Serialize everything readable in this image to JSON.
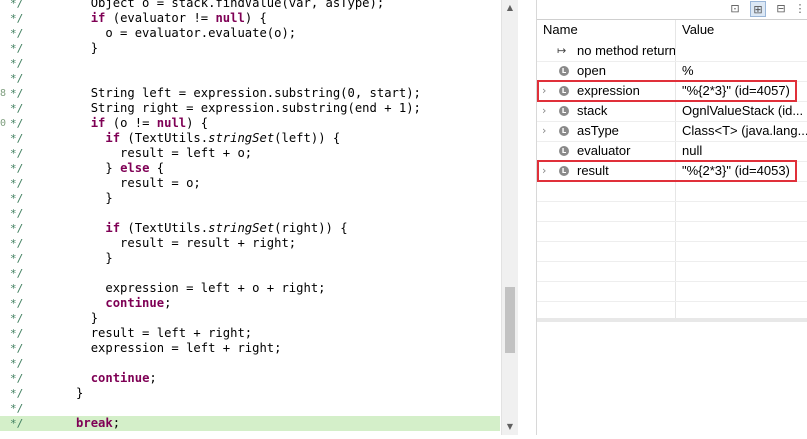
{
  "editor": {
    "lines": [
      {
        "g": "*/",
        "mark": "",
        "code": [
          {
            "t": "        Object o = stack.findValue(var, asType);"
          }
        ]
      },
      {
        "g": "*/",
        "mark": "",
        "code": [
          {
            "t": "        "
          },
          {
            "t": "if",
            "c": "kw"
          },
          {
            "t": " (evaluator != "
          },
          {
            "t": "null",
            "c": "kw"
          },
          {
            "t": ") {"
          }
        ]
      },
      {
        "g": "*/",
        "mark": "",
        "code": [
          {
            "t": "          o = evaluator.evaluate(o);"
          }
        ]
      },
      {
        "g": "*/",
        "mark": "",
        "code": [
          {
            "t": "        }"
          }
        ]
      },
      {
        "g": "*/",
        "mark": "",
        "code": []
      },
      {
        "g": "*/",
        "mark": "",
        "code": []
      },
      {
        "g": "*/",
        "mark": "8",
        "code": [
          {
            "t": "        String left = expression.substring(0, start);"
          }
        ]
      },
      {
        "g": "*/",
        "mark": "",
        "code": [
          {
            "t": "        String right = expression.substring(end + 1);"
          }
        ]
      },
      {
        "g": "*/",
        "mark": "0",
        "code": [
          {
            "t": "        "
          },
          {
            "t": "if",
            "c": "kw"
          },
          {
            "t": " (o != "
          },
          {
            "t": "null",
            "c": "kw"
          },
          {
            "t": ") {"
          }
        ]
      },
      {
        "g": "*/",
        "mark": "",
        "code": [
          {
            "t": "          "
          },
          {
            "t": "if",
            "c": "kw"
          },
          {
            "t": " (TextUtils."
          },
          {
            "t": "stringSet",
            "c": "it"
          },
          {
            "t": "(left)) {"
          }
        ]
      },
      {
        "g": "*/",
        "mark": "",
        "code": [
          {
            "t": "            result = left + o;"
          }
        ]
      },
      {
        "g": "*/",
        "mark": "",
        "code": [
          {
            "t": "          } "
          },
          {
            "t": "else",
            "c": "kw"
          },
          {
            "t": " {"
          }
        ]
      },
      {
        "g": "*/",
        "mark": "",
        "code": [
          {
            "t": "            result = o;"
          }
        ]
      },
      {
        "g": "*/",
        "mark": "",
        "code": [
          {
            "t": "          }"
          }
        ]
      },
      {
        "g": "*/",
        "mark": "",
        "code": []
      },
      {
        "g": "*/",
        "mark": "",
        "code": [
          {
            "t": "          "
          },
          {
            "t": "if",
            "c": "kw"
          },
          {
            "t": " (TextUtils."
          },
          {
            "t": "stringSet",
            "c": "it"
          },
          {
            "t": "(right)) {"
          }
        ]
      },
      {
        "g": "*/",
        "mark": "",
        "code": [
          {
            "t": "            result = result + right;"
          }
        ]
      },
      {
        "g": "*/",
        "mark": "",
        "code": [
          {
            "t": "          }"
          }
        ]
      },
      {
        "g": "*/",
        "mark": "",
        "code": []
      },
      {
        "g": "*/",
        "mark": "",
        "code": [
          {
            "t": "          expression = left + o + right;"
          }
        ]
      },
      {
        "g": "*/",
        "mark": "",
        "code": [
          {
            "t": "          "
          },
          {
            "t": "continue",
            "c": "kw"
          },
          {
            "t": ";"
          }
        ]
      },
      {
        "g": "*/",
        "mark": "",
        "code": [
          {
            "t": "        }"
          }
        ]
      },
      {
        "g": "*/",
        "mark": "",
        "code": [
          {
            "t": "        result = left + right;"
          }
        ]
      },
      {
        "g": "*/",
        "mark": "",
        "code": [
          {
            "t": "        expression = left + right;"
          }
        ]
      },
      {
        "g": "*/",
        "mark": "",
        "code": []
      },
      {
        "g": "*/",
        "mark": "",
        "code": [
          {
            "t": "        "
          },
          {
            "t": "continue",
            "c": "kw"
          },
          {
            "t": ";"
          }
        ]
      },
      {
        "g": "*/",
        "mark": "",
        "code": [
          {
            "t": "      }"
          }
        ]
      },
      {
        "g": "*/",
        "mark": "",
        "code": []
      },
      {
        "g": "*/",
        "mark": "",
        "hl": true,
        "code": [
          {
            "t": "      "
          },
          {
            "t": "break",
            "c": "kw"
          },
          {
            "t": ";"
          }
        ]
      }
    ]
  },
  "variables": {
    "columns": {
      "name": "Name",
      "value": "Value"
    },
    "rows": [
      {
        "name": "no method return",
        "value": "",
        "icon": "return-icon",
        "expandable": false
      },
      {
        "name": "open",
        "value": "%",
        "icon": "local-var-icon",
        "expandable": false
      },
      {
        "name": "expression",
        "value": "\"%{2*3}\" (id=4057)",
        "icon": "local-var-icon",
        "expandable": true,
        "highlight": true
      },
      {
        "name": "stack",
        "value": "OgnlValueStack  (id...",
        "icon": "local-var-icon",
        "expandable": true
      },
      {
        "name": "asType",
        "value": "Class<T> (java.lang....",
        "icon": "local-var-icon",
        "expandable": true
      },
      {
        "name": "evaluator",
        "value": "null",
        "icon": "local-var-icon",
        "expandable": false
      },
      {
        "name": "result",
        "value": "\"%{2*3}\" (id=4053)",
        "icon": "local-var-icon",
        "expandable": true,
        "highlight": true
      }
    ],
    "icon_glyph": "L",
    "return_glyph": "↦"
  },
  "colors": {
    "keyword": "#7f0055",
    "highlight_box": "#e0303a",
    "current_line": "#d4efc9"
  }
}
